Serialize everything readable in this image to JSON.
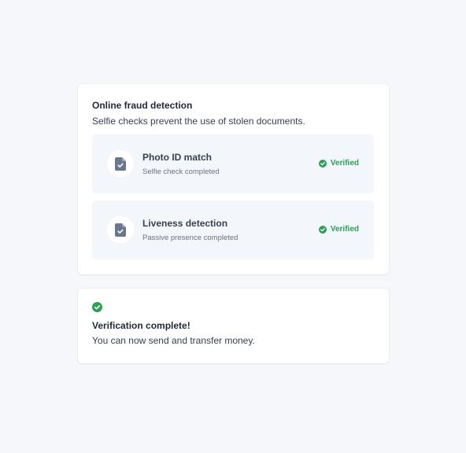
{
  "colors": {
    "page_background": "#f5f7fb",
    "card_background": "#ffffff",
    "item_background": "#f3f6fa",
    "success_green": "#2f9e57",
    "document_icon": "#6b778c"
  },
  "fraud_card": {
    "title": "Online fraud detection",
    "subtitle": "Selfie checks prevent the use of stolen documents.",
    "items": [
      {
        "icon": "document-check-icon",
        "title": "Photo ID match",
        "description": "Selfie check completed",
        "status_icon": "check-circle-icon",
        "status": "Verified"
      },
      {
        "icon": "document-check-icon",
        "title": "Liveness detection",
        "description": "Passive presence completed",
        "status_icon": "check-circle-icon",
        "status": "Verified"
      }
    ]
  },
  "complete_card": {
    "icon": "check-circle-icon",
    "title": "Verification complete!",
    "message": "You can now send and transfer money."
  }
}
